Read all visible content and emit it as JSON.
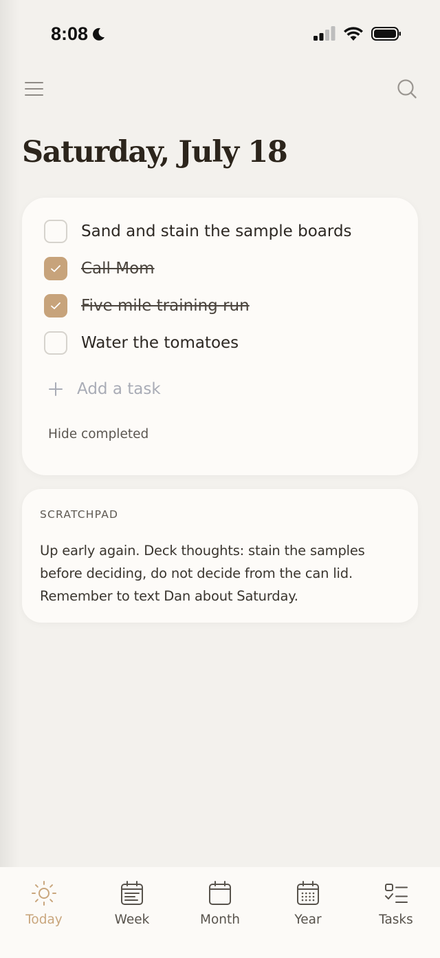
{
  "status_bar": {
    "time": "8:08"
  },
  "header": {
    "title": "Saturday, July 18"
  },
  "tasks": {
    "items": [
      {
        "label": "Sand and stain the sample boards",
        "completed": false
      },
      {
        "label": "Call Mom",
        "completed": true
      },
      {
        "label": "Five mile training run",
        "completed": true
      },
      {
        "label": "Water the tomatoes",
        "completed": false
      }
    ],
    "add_placeholder": "Add a task",
    "hide_completed_label": "Hide completed"
  },
  "scratchpad": {
    "heading": "SCRATCHPAD",
    "text": "Up early again. Deck thoughts: stain the samples before deciding, do not decide from the can lid. Remember to text Dan about Saturday."
  },
  "tab_bar": {
    "tabs": [
      {
        "label": "Today",
        "icon": "sun-icon",
        "active": true
      },
      {
        "label": "Week",
        "icon": "calendar-week-icon",
        "active": false
      },
      {
        "label": "Month",
        "icon": "calendar-month-icon",
        "active": false
      },
      {
        "label": "Year",
        "icon": "calendar-year-icon",
        "active": false
      },
      {
        "label": "Tasks",
        "icon": "checklist-icon",
        "active": false
      }
    ]
  },
  "colors": {
    "accent": "#c7a37b",
    "background": "#f3f1ed",
    "card": "#fdfbf8"
  }
}
